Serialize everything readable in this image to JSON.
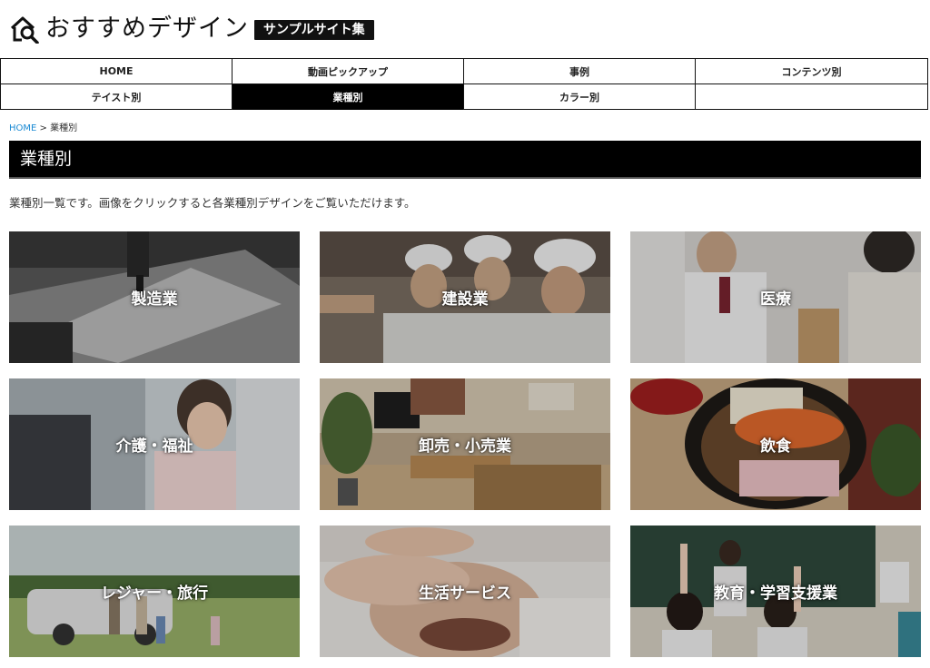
{
  "header": {
    "logo_text": "おすすめデザイン",
    "badge": "サンプルサイト集"
  },
  "nav": [
    {
      "label": "HOME",
      "active": false
    },
    {
      "label": "動画ピックアップ",
      "active": false
    },
    {
      "label": "事例",
      "active": false
    },
    {
      "label": "コンテンツ別",
      "active": false
    },
    {
      "label": "テイスト別",
      "active": false
    },
    {
      "label": "業種別",
      "active": true
    },
    {
      "label": "カラー別",
      "active": false
    },
    {
      "label": "",
      "active": false
    }
  ],
  "breadcrumb": {
    "home": "HOME",
    "separator": ">",
    "current": "業種別"
  },
  "page_title": "業種別",
  "intro": "業種別一覧です。画像をクリックすると各業種別デザインをご覧いただけます。",
  "categories": [
    {
      "label": "製造業",
      "image": "factory-machining-photo"
    },
    {
      "label": "建設業",
      "image": "construction-workers-photo"
    },
    {
      "label": "医療",
      "image": "doctor-patient-photo"
    },
    {
      "label": "介護・福祉",
      "image": "caregiver-photo"
    },
    {
      "label": "卸売・小売業",
      "image": "living-room-furniture-photo"
    },
    {
      "label": "飲食",
      "image": "japanese-dish-photo"
    },
    {
      "label": "レジャー・旅行",
      "image": "family-car-field-photo"
    },
    {
      "label": "生活サービス",
      "image": "head-massage-photo"
    },
    {
      "label": "教育・学習支援業",
      "image": "classroom-photo"
    }
  ],
  "colors": {
    "link": "#1a8ad4",
    "nav_active_bg": "#000000",
    "title_bar_bg": "#000000"
  }
}
